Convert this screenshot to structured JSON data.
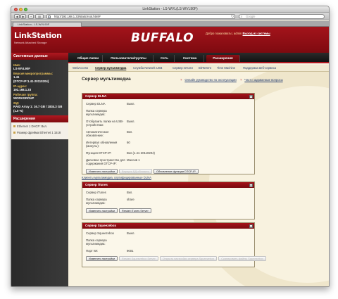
{
  "browser": {
    "window_title": "LinkStation - LS-WVL(LS-WVL90F)",
    "back": "◀",
    "forward": "▶",
    "plus": "+",
    "url": "http://192.168.1.33/static/root.html#",
    "search_placeholder": "Google",
    "tab_title": "LinkStation - LS-WVL90F"
  },
  "header": {
    "product": "LinkStation",
    "product_sub": "Network Attached Storage",
    "brand": "BUFFALO",
    "welcome": "Добро пожаловать!, admin",
    "logout": "Выход из системы"
  },
  "sidebar": {
    "system_title": "Системные данные",
    "info": [
      {
        "label": "Имя:",
        "value": "LS-WVL90F"
      },
      {
        "label": "Версия микропрограммы:",
        "value": "1.41\n(DTCP-IP:1.41-20110204)"
      },
      {
        "label": "IP-адрес:",
        "value": "192.168.1.33"
      },
      {
        "label": "Рабочая группа:",
        "value": "WORKGROUP"
      },
      {
        "label": "ЖД:",
        "value": "RAID Array 1: 16.7 GB / 1834.3 GB (1.0 %)"
      }
    ],
    "recent_title": "Расширения",
    "recent": [
      "Ethernet 1 DHCP: Вкл.",
      "Размер фрейма Ethernet 1 1518"
    ]
  },
  "mainnav": [
    "Общие папки",
    "Пользователи/группы",
    "Сеть",
    "Система",
    "Расширения"
  ],
  "mainnav_active": "Расширения",
  "subnav": [
    {
      "label": "WebAccess",
      "active": false
    },
    {
      "label": "Сервер мультимедиа",
      "active": true
    },
    {
      "label": "Служба Network USB",
      "active": false
    },
    {
      "label": "Сервер печати",
      "active": false
    },
    {
      "label": "BitTorrent",
      "active": false
    },
    {
      "label": "Time Machine",
      "active": false
    },
    {
      "label": "Поддержка веб-сервиса",
      "active": false
    }
  ],
  "page": {
    "title": "Сервер мультимедиа",
    "help_manual": "Онлайн руководство по эксплуатации",
    "help_faq": "Часто задаваемые вопросы"
  },
  "dlna": {
    "title": "Сервер DLNA",
    "rows": [
      {
        "k": "Сервер DLNA",
        "v": "Выкл."
      },
      {
        "k": "Папка сервера мультимедиа:",
        "v": ""
      },
      {
        "k": "Отобразить папки на USB-устройствах:",
        "v": "Выкл."
      },
      {
        "k": "Автоматическое обновление:",
        "v": "Вкл."
      },
      {
        "k": "Интервал обновления (минуты):",
        "v": "60"
      },
      {
        "k": "Функция DTCP-IP:",
        "v": "Вкл.(1.41-20110204)"
      },
      {
        "k": "Дисковое пространство для содержания DTCP-IP:",
        "v": "Массив 1"
      }
    ],
    "buttons": [
      "Изменить настройки",
      "Вернуть БД обновить",
      "Обновление функции DTCP-IP"
    ]
  },
  "cert_link": "Клиенты мультимедиа, сертифицированные DLNA",
  "itunes": {
    "title": "Сервер iTunes",
    "rows": [
      {
        "k": "Сервер iTunes",
        "v": "Вкл."
      },
      {
        "k": "Папка сервера мультимедиа:",
        "v": "share"
      }
    ],
    "buttons": [
      "Изменить настройки",
      "Restart iTunes Server"
    ]
  },
  "squeeze": {
    "title": "Сервер Squeezebox",
    "rows": [
      {
        "k": "Сервер Squeezebox",
        "v": "Выкл."
      },
      {
        "k": "Папка сервера мультимедиа:",
        "v": ""
      },
      {
        "k": "Порт WI:",
        "v": "9001"
      }
    ],
    "buttons": [
      "Изменить настройки",
      "Restart Squeezebox Server",
      "Открыть настройки сервера Squeezebox",
      "Сканировать файлы Squeezebox"
    ]
  }
}
